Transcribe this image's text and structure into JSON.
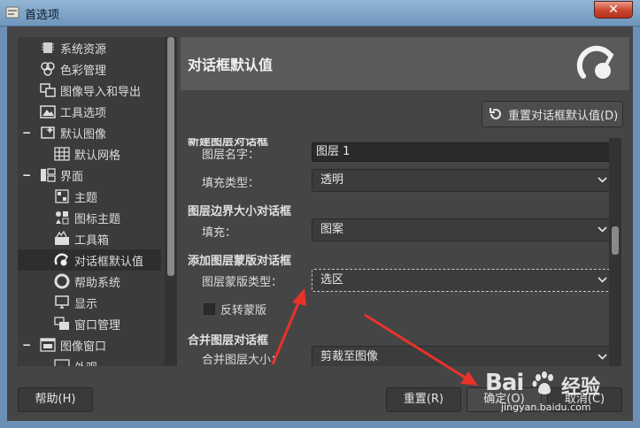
{
  "window": {
    "title": "首选项",
    "close_glyph": "✕"
  },
  "sidebar": {
    "items": [
      {
        "label": "系统资源",
        "icon": "chip-icon",
        "level": 1
      },
      {
        "label": "色彩管理",
        "icon": "color-circles-icon",
        "level": 1
      },
      {
        "label": "图像导入和导出",
        "icon": "image-import-icon",
        "level": 1
      },
      {
        "label": "工具选项",
        "icon": "tool-options-icon",
        "level": 1
      },
      {
        "label": "默认图像",
        "icon": "default-image-icon",
        "level": 0,
        "expander": "−"
      },
      {
        "label": "默认网格",
        "icon": "grid-icon",
        "level": 1
      },
      {
        "label": "界面",
        "icon": "interface-icon",
        "level": 0,
        "expander": "−"
      },
      {
        "label": "主题",
        "icon": "theme-icon",
        "level": 1
      },
      {
        "label": "图标主题",
        "icon": "icon-theme-icon",
        "level": 1
      },
      {
        "label": "工具箱",
        "icon": "toolbox-icon",
        "level": 1
      },
      {
        "label": "对话框默认值",
        "icon": "gauge-icon",
        "level": 1,
        "selected": true
      },
      {
        "label": "帮助系统",
        "icon": "lifebuoy-icon",
        "level": 1
      },
      {
        "label": "显示",
        "icon": "monitor-icon",
        "level": 1
      },
      {
        "label": "窗口管理",
        "icon": "windows-icon",
        "level": 1
      },
      {
        "label": "图像窗口",
        "icon": "image-window-icon",
        "level": 0,
        "expander": "−"
      },
      {
        "label": "外观",
        "icon": "appearance-icon",
        "level": 1
      }
    ]
  },
  "header": {
    "title": "对话框默认值",
    "icon": "gauge-icon"
  },
  "reset_defaults_label": "重置对话框默认值(D)",
  "settings": {
    "partial_section_title": "新建图层对话框",
    "layer_name_label": "图层名字：",
    "layer_name_value": "图层 1",
    "fill_type_label": "填充类型：",
    "fill_type_value": "透明",
    "boundary_section_title": "图层边界大小对话框",
    "boundary_fill_label": "填充：",
    "boundary_fill_value": "图案",
    "mask_section_title": "添加图层蒙版对话框",
    "mask_type_label": "图层蒙版类型：",
    "mask_type_value": "选区",
    "invert_mask_label": "反转蒙版",
    "merge_section_title": "合并图层对话框",
    "merge_size_label": "合并图层大小：",
    "merge_size_value": "剪裁至图像"
  },
  "buttons": {
    "help": "帮助(H)",
    "reset": "重置(R)",
    "ok": "确定(O)",
    "cancel": "取消(C)"
  },
  "watermark": {
    "brand": "Bai",
    "suffix": "经验",
    "url": "jingyan.baidu.com"
  },
  "colors": {
    "annotation_arrow": "#e8322a",
    "panel_bg": "#454545",
    "titlebar": "#7ea3c7"
  }
}
